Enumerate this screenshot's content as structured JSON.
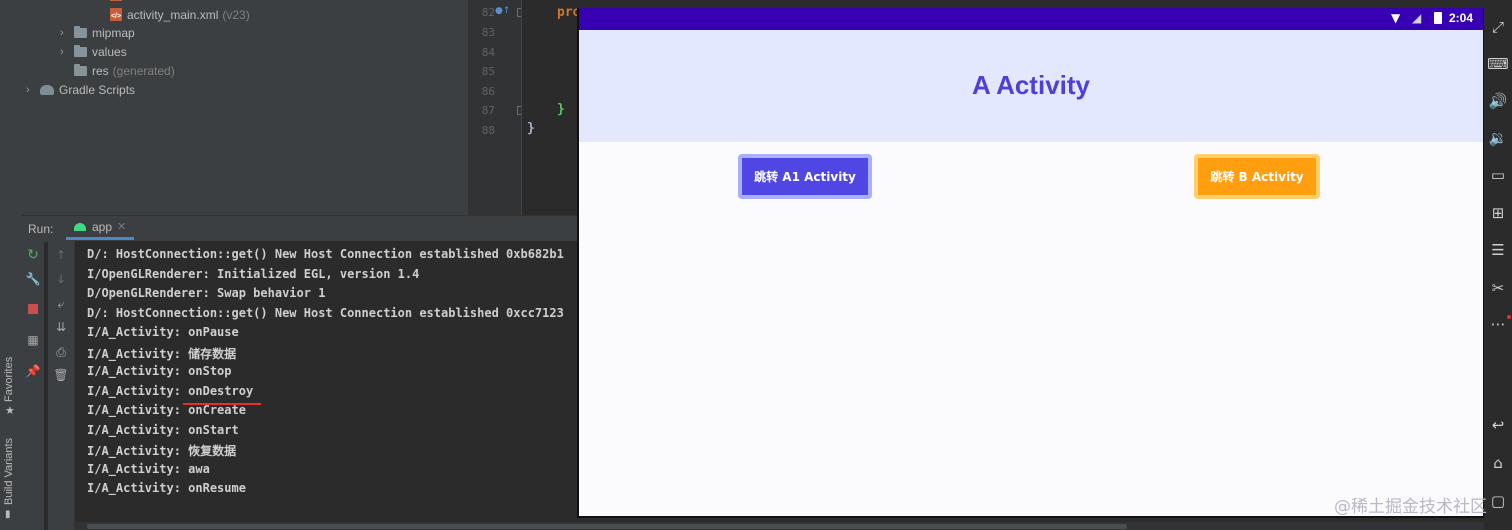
{
  "favorites_label": "Favorites",
  "build_variants_label": "Build Variants",
  "project_tree": {
    "items": [
      {
        "label": "activity_main.xml",
        "suffix": "(v23)"
      },
      {
        "label": "mipmap"
      },
      {
        "label": "values"
      },
      {
        "label": "res",
        "suffix": "(generated)"
      },
      {
        "label": "Gradle Scripts"
      }
    ]
  },
  "editor": {
    "line_numbers": [
      "82",
      "83",
      "84",
      "85",
      "86",
      "87",
      "88"
    ],
    "code": {
      "line82": "pro",
      "line87": "}",
      "line88": "}"
    }
  },
  "run_panel": {
    "label": "Run:",
    "tab": "app",
    "console_lines": [
      "D/: HostConnection::get() New Host Connection established 0xb682b1",
      "I/OpenGLRenderer: Initialized EGL, version 1.4",
      "D/OpenGLRenderer: Swap behavior 1",
      "D/: HostConnection::get() New Host Connection established 0xcc7123",
      "I/A_Activity: onPause",
      "I/A_Activity: 储存数据",
      "I/A_Activity: onStop",
      "I/A_Activity: onDestroy",
      "I/A_Activity: onCreate",
      "I/A_Activity: onStart",
      "I/A_Activity: 恢复数据",
      "I/A_Activity: awa",
      "I/A_Activity: onResume"
    ]
  },
  "emulator": {
    "time": "2:04",
    "title": "A Activity",
    "button_a1": "跳转 A1 Activity",
    "button_b": "跳转 B Activity"
  },
  "watermark": "@稀土掘金技术社区",
  "colors": {
    "status_bar": "#3700b3",
    "header_bg": "#e3e8ff",
    "title": "#4f3fd9",
    "button_a1": "#5046e4",
    "button_b": "#ff9f10",
    "underline": "#e03030"
  },
  "side_icons": [
    "expand-icon",
    "keyboard-icon",
    "volume-up-icon",
    "volume-down-icon",
    "screen-icon",
    "screenshot-icon",
    "layers-icon",
    "cut-icon",
    "more-icon",
    "back-icon",
    "home-icon",
    "overview-icon"
  ]
}
